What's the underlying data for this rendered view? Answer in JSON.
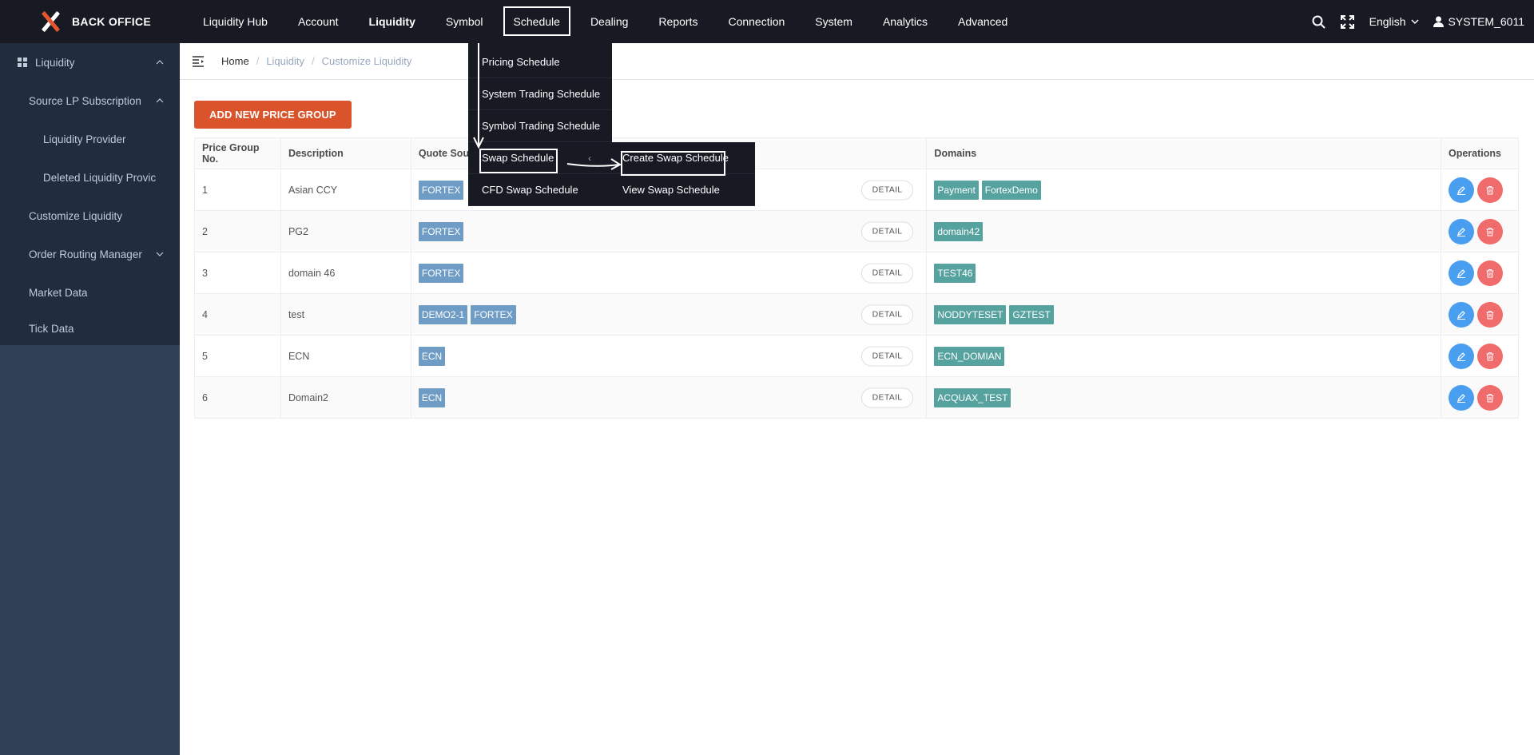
{
  "brand": {
    "name": "BACK OFFICE"
  },
  "nav": {
    "items": [
      {
        "label": "Liquidity Hub"
      },
      {
        "label": "Account"
      },
      {
        "label": "Liquidity"
      },
      {
        "label": "Symbol"
      },
      {
        "label": "Schedule"
      },
      {
        "label": "Dealing"
      },
      {
        "label": "Reports"
      },
      {
        "label": "Connection"
      },
      {
        "label": "System"
      },
      {
        "label": "Analytics"
      },
      {
        "label": "Advanced"
      }
    ],
    "active": "Liquidity",
    "highlighted": "Schedule"
  },
  "topRight": {
    "language": "English",
    "user": "SYSTEM_6011"
  },
  "sidebar": {
    "items": [
      {
        "label": "Liquidity"
      },
      {
        "label": "Source LP Subscription"
      },
      {
        "label": "Liquidity Provider"
      },
      {
        "label": "Deleted Liquidity Provic"
      },
      {
        "label": "Customize Liquidity"
      },
      {
        "label": "Order Routing Manager"
      },
      {
        "label": "Market Data"
      },
      {
        "label": "Tick Data"
      }
    ]
  },
  "breadcrumb": {
    "home": "Home",
    "section": "Liquidity",
    "page": "Customize Liquidity"
  },
  "addButton": "ADD NEW PRICE GROUP",
  "table": {
    "headers": [
      "Price Group No.",
      "Description",
      "Quote Sour",
      "Domains",
      "Operations"
    ],
    "detailLabel": "DETAIL",
    "rows": [
      {
        "no": "1",
        "desc": "Asian CCY",
        "sources": [
          "FORTEX"
        ],
        "domains": [
          "Payment",
          "FortexDemo"
        ]
      },
      {
        "no": "2",
        "desc": "PG2",
        "sources": [
          "FORTEX"
        ],
        "domains": [
          "domain42"
        ]
      },
      {
        "no": "3",
        "desc": "domain 46",
        "sources": [
          "FORTEX"
        ],
        "domains": [
          "TEST46"
        ]
      },
      {
        "no": "4",
        "desc": "test",
        "sources": [
          "DEMO2-1",
          "FORTEX"
        ],
        "domains": [
          "NODDYTESET",
          "GZTEST"
        ]
      },
      {
        "no": "5",
        "desc": "ECN",
        "sources": [
          "ECN"
        ],
        "domains": [
          "ECN_DOMIAN"
        ]
      },
      {
        "no": "6",
        "desc": "Domain2",
        "sources": [
          "ECN"
        ],
        "domains": [
          "ACQUAX_TEST"
        ]
      }
    ]
  },
  "scheduleMenu": {
    "items": [
      {
        "label": "Pricing Schedule"
      },
      {
        "label": "System Trading Schedule"
      },
      {
        "label": "Symbol Trading Schedule"
      },
      {
        "label": "Swap Schedule"
      },
      {
        "label": "CFD Swap Schedule"
      }
    ]
  },
  "swapSubmenu": {
    "items": [
      {
        "label": "Create Swap Schedule"
      },
      {
        "label": "View Swap Schedule"
      }
    ]
  },
  "colors": {
    "topbar": "#171923",
    "sidebar": "#304156",
    "accent": "#d9532b",
    "sourceTag": "#6f9cc4",
    "domainTag": "#56a29f",
    "editBtn": "#4a9ef0",
    "deleteBtn": "#f06b6b"
  }
}
